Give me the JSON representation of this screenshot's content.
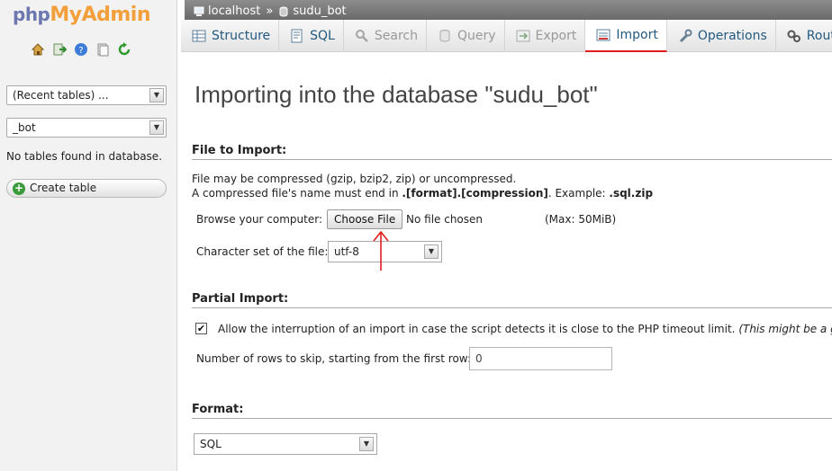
{
  "app": {
    "logo_php": "php",
    "logo_myadmin": "MyAdmin"
  },
  "sidebar": {
    "quick_icons": [
      "home-icon",
      "logout-icon",
      "help-icon",
      "docs-icon",
      "reload-icon"
    ],
    "recent_tables": "(Recent tables) ...",
    "database": "_bot",
    "no_tables": "No tables found in database.",
    "create_table": "Create table"
  },
  "breadcrumb": {
    "server": "localhost",
    "separator": "»",
    "database": "sudu_bot"
  },
  "tabs": [
    {
      "label": "Structure",
      "icon": "structure-icon",
      "state": "normal"
    },
    {
      "label": "SQL",
      "icon": "sql-icon",
      "state": "normal"
    },
    {
      "label": "Search",
      "icon": "search-icon",
      "state": "disabled"
    },
    {
      "label": "Query",
      "icon": "query-icon",
      "state": "disabled"
    },
    {
      "label": "Export",
      "icon": "export-icon",
      "state": "disabled"
    },
    {
      "label": "Import",
      "icon": "import-icon",
      "state": "active"
    },
    {
      "label": "Operations",
      "icon": "wrench-icon",
      "state": "normal"
    },
    {
      "label": "Routines",
      "icon": "routines-icon",
      "state": "normal"
    }
  ],
  "main": {
    "title": "Importing into the database \"sudu_bot\"",
    "file_import": {
      "heading": "File to Import:",
      "line1": "File may be compressed (gzip, bzip2, zip) or uncompressed.",
      "line2_prefix": "A compressed file's name must end in ",
      "line2_format": ".[format].[compression]",
      "line2_example_label": ". Example: ",
      "line2_example": ".sql.zip",
      "browse_label": "Browse your computer:",
      "choose_button": "Choose File",
      "no_file": "No file chosen",
      "max_size": "(Max: 50MiB)",
      "charset_label": "Character set of the file:",
      "charset_value": "utf-8"
    },
    "partial_import": {
      "heading": "Partial Import:",
      "allow_checked": true,
      "allow_label": "Allow the interruption of an import in case the script detects it is close to the PHP timeout limit.",
      "allow_note": "(This might be a good",
      "skip_label": "Number of rows to skip, starting from the first row:",
      "skip_value": "0"
    },
    "format": {
      "heading": "Format:",
      "value": "SQL"
    }
  },
  "colors": {
    "tab_text": "#235a81",
    "active_underline": "#e11d1d",
    "annotation_arrow": "#e11d1d"
  }
}
